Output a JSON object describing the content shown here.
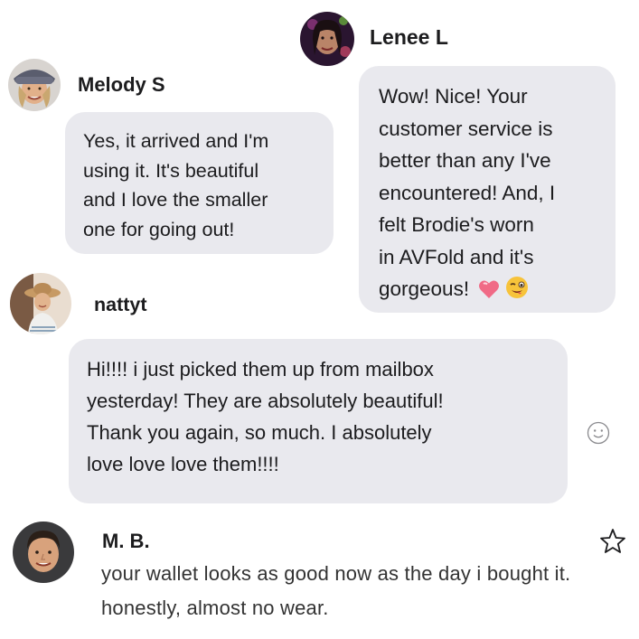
{
  "messages": [
    {
      "author": "Lenee L",
      "avatar_icon": "lenee-avatar",
      "text": "Wow! Nice! Your\ncustomer service is\nbetter than any I've\nencountered! And, I\nfelt Brodie's worn\nin AVFold and it's\ngorgeous!",
      "emojis": [
        "heart-emoji",
        "winking-face-emoji"
      ]
    },
    {
      "author": "Melody S",
      "avatar_icon": "melody-avatar",
      "text": "Yes, it arrived and I'm\nusing it. It's beautiful\nand I love the smaller\none for going out!"
    },
    {
      "author": "nattyt",
      "avatar_icon": "nattyt-avatar",
      "text": "Hi!!!!  i just picked  them up from mailbox\nyesterday! They are absolutely beautiful!\nThank you again, so much. I absolutely\nlove love love them!!!!",
      "reaction_icon": "smiley-reaction-icon"
    },
    {
      "author": "M. B.",
      "avatar_icon": "mb-avatar",
      "text": "your wallet looks as good now as the day i bought it.\nhonestly, almost no wear.",
      "action_icon": "star-icon"
    }
  ],
  "colors": {
    "bubble": "#e9e9ee",
    "text": "#1c1c1e",
    "review_text": "#333333"
  }
}
